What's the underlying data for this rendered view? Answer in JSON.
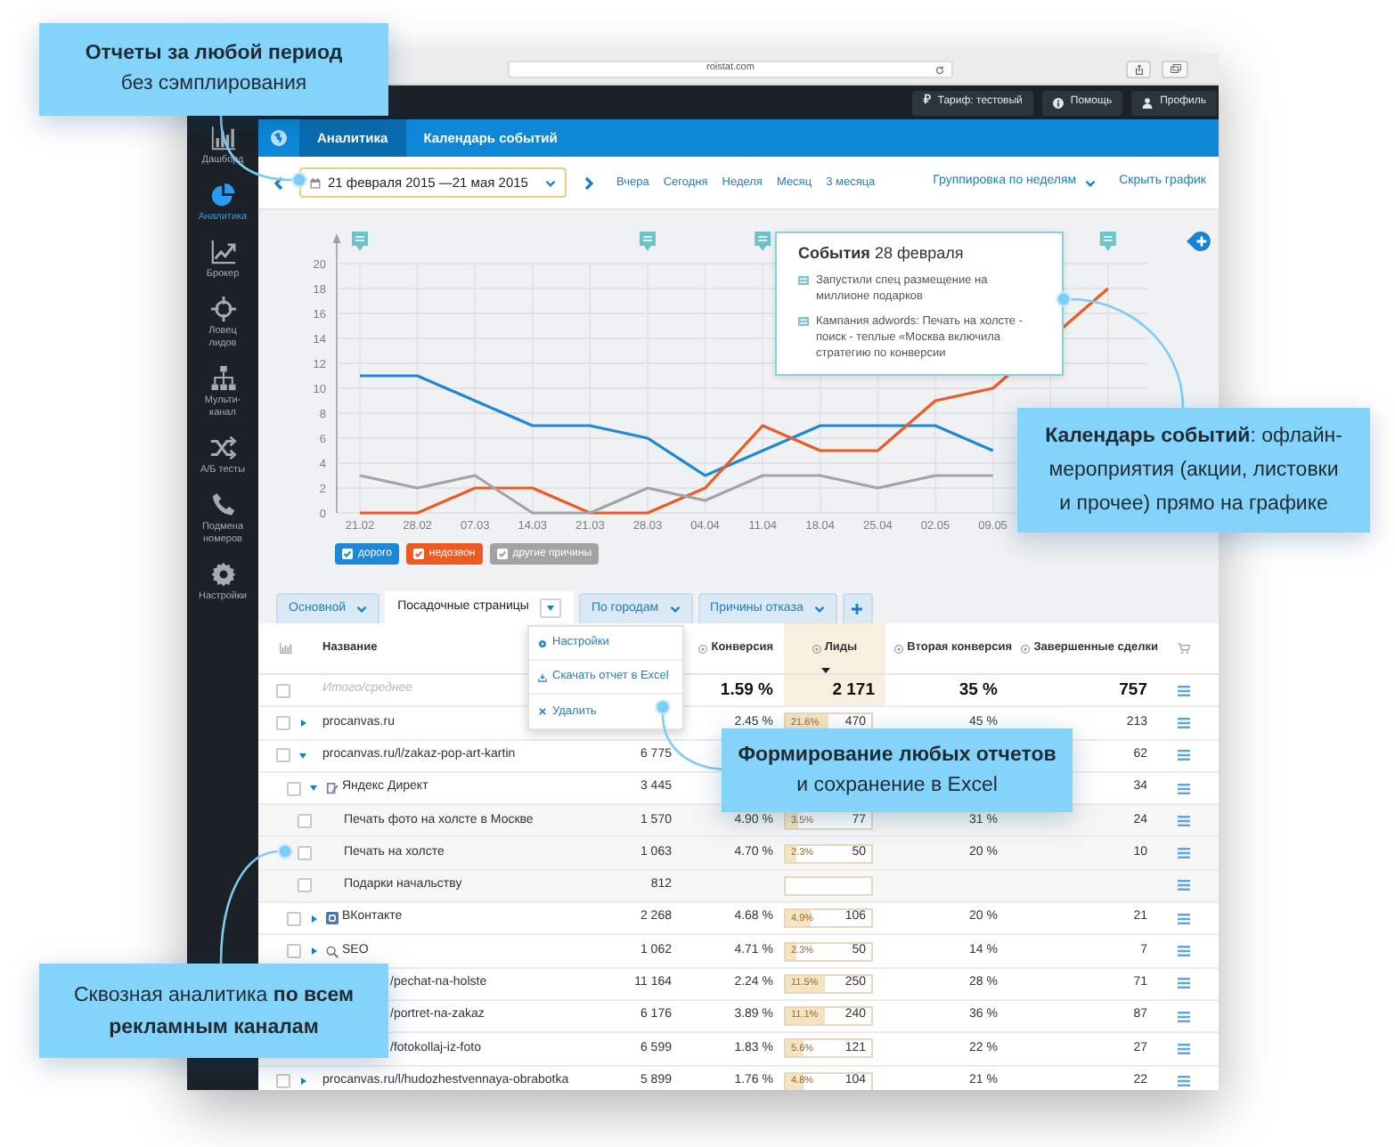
{
  "browser": {
    "url": "roistat.com"
  },
  "header": {
    "buttons": [
      {
        "kind": "tariff",
        "symbol": "₽",
        "label": "Тариф: тестовый"
      },
      {
        "kind": "help",
        "label": "Помощь"
      },
      {
        "kind": "profile",
        "label": "Профиль"
      }
    ]
  },
  "sidebar": {
    "items": [
      {
        "kind": "dashboard",
        "label": "Дашборд",
        "selected": false
      },
      {
        "kind": "analytics",
        "label": "Аналитика",
        "selected": true
      },
      {
        "kind": "broker",
        "label": "Брокер",
        "selected": false
      },
      {
        "kind": "leads",
        "label": "Ловец\nлидов",
        "selected": false
      },
      {
        "kind": "multichannel",
        "label": "Мульти-\nканал",
        "selected": false
      },
      {
        "kind": "ab",
        "label": "А/Б тесты",
        "selected": false
      },
      {
        "kind": "phones",
        "label": "Подмена\nномеров",
        "selected": false
      },
      {
        "kind": "settings",
        "label": "Настройки",
        "selected": false
      }
    ]
  },
  "nav": {
    "tabs": [
      {
        "label": "Аналитика",
        "selected": true
      },
      {
        "label": "Календарь событий",
        "selected": false
      }
    ]
  },
  "date_bar": {
    "range": "21 февраля 2015 —21 мая 2015",
    "quick_ranges": [
      "Вчера",
      "Сегодня",
      "Неделя",
      "Месяц",
      "3 месяца"
    ],
    "grouping": "Группировка по неделям",
    "hide_chart": "Скрыть график"
  },
  "chart": {
    "chart_data": {
      "type": "line",
      "grid": true,
      "categories": [
        "21.02",
        "28.02",
        "07.03",
        "14.03",
        "21.03",
        "28.03",
        "04.04",
        "11.04",
        "18.04",
        "25.04",
        "02.05",
        "09.05",
        null,
        null
      ],
      "ylim": [
        0,
        20
      ],
      "yticks": [
        0,
        2,
        4,
        6,
        8,
        10,
        12,
        14,
        16,
        18,
        20
      ],
      "series": [
        {
          "name": "дорого",
          "color": "#1e88d8",
          "values": [
            11,
            11,
            9,
            7,
            7,
            6,
            3,
            5,
            7,
            7,
            7,
            5,
            null,
            null
          ]
        },
        {
          "name": "недозвон",
          "color": "#ee5a24",
          "values": [
            0,
            0,
            2,
            2,
            0,
            0,
            2,
            7,
            5,
            5,
            9,
            10,
            null,
            18
          ]
        },
        {
          "name": "другие причины",
          "color": "#a3a3a3",
          "values": [
            3,
            2,
            3,
            0,
            0,
            2,
            1,
            3,
            3,
            2,
            3,
            3,
            null,
            null
          ]
        }
      ]
    },
    "legend": [
      {
        "checked": true
      },
      {
        "checked": true
      },
      {
        "checked": true
      }
    ],
    "popup": {
      "title": "**События** 28 февраля",
      "items": [
        "Запустили спец размещение на миллионе подарков",
        "Кампания adwords: Печать на холсте - поиск - теплые «Москва включила стратегию по конверсии"
      ]
    }
  },
  "report_tabs": [
    {
      "label": "Основной",
      "selected": false
    },
    {
      "label": "Посадочные страницы",
      "selected": true
    },
    {
      "label": "По городам",
      "selected": false
    },
    {
      "label": "Причины отказа",
      "selected": false
    }
  ],
  "tab_menu": {
    "items": [
      {
        "kind": "settings",
        "label": "Настройки"
      },
      {
        "kind": "download",
        "label": "Скачать отчет в Excel"
      },
      {
        "kind": "delete",
        "label": "Удалить"
      }
    ]
  },
  "table": {
    "columns": [
      {
        "kind": "name",
        "label": "Название"
      },
      {
        "kind": "metric",
        "label": "Конверсия",
        "sorted": false
      },
      {
        "kind": "metric",
        "label": "Лиды",
        "sorted": true
      },
      {
        "kind": "metric",
        "label": "Вторая конверсия",
        "sorted": false
      },
      {
        "kind": "metric",
        "label": "Завершенные сделки",
        "sorted": false
      }
    ],
    "rows": [
      {
        "kind": "total",
        "name": "Итого/среднее",
        "checked": false,
        "conversion": "1.59 %",
        "leads": {
          "value": "2 171"
        },
        "second_conversion": "35 %",
        "deals": "757"
      },
      {
        "kind": "page",
        "name": "procanvas.ru",
        "checked": false,
        "expanded": false,
        "conversion": "2.45 %",
        "leads": {
          "share": "21.6%",
          "value": "470",
          "level": 0.5
        },
        "second_conversion": "45 %",
        "deals": "213"
      },
      {
        "kind": "page",
        "name": "procanvas.ru/l/zakaz-pop-art-kartin",
        "checked": false,
        "expanded": true,
        "visits": "6 775",
        "deals": "62",
        "children": [
          {
            "kind": "direct",
            "name": "Яндекс Директ",
            "checked": false,
            "expanded": true,
            "visits": "3 445",
            "deals": "34",
            "children": [
              {
                "kind": "phrase",
                "name": "Печать фото на холсте в Москве",
                "checked": false,
                "visits": "1 570",
                "conversion": "4.90 %",
                "leads": {
                  "share": "3.5%",
                  "value": "77",
                  "level": 0.15
                },
                "second_conversion": "31 %",
                "deals": "24"
              },
              {
                "kind": "phrase",
                "name": "Печать на холсте",
                "checked": false,
                "visits": "1 063",
                "conversion": "4.70 %",
                "leads": {
                  "share": "2.3%",
                  "value": "50",
                  "level": 0.12
                },
                "second_conversion": "20 %",
                "deals": "10"
              },
              {
                "kind": "phrase",
                "name": "Подарки начальству",
                "checked": false,
                "visits": "812",
                "leads": {
                  "level": 0
                }
              }
            ]
          },
          {
            "kind": "vk",
            "name": "ВКонтакте",
            "checked": false,
            "expanded": false,
            "visits": "2 268",
            "conversion": "4.68 %",
            "leads": {
              "share": "4.9%",
              "value": "106",
              "level": 0.3
            },
            "second_conversion": "20 %",
            "deals": "21"
          },
          {
            "kind": "seo",
            "name": "SEO",
            "checked": false,
            "expanded": false,
            "visits": "1 062",
            "conversion": "4.71 %",
            "leads": {
              "share": "2.3%",
              "value": "50",
              "level": 0.12
            },
            "second_conversion": "14 %",
            "deals": "7"
          }
        ]
      },
      {
        "kind": "page_tail",
        "name": "/pechat-na-holste",
        "visits": "11 164",
        "conversion": "2.24 %",
        "leads": {
          "share": "11.5%",
          "value": "250",
          "level": 0.45
        },
        "second_conversion": "28 %",
        "deals": "71"
      },
      {
        "kind": "page_tail",
        "name": "/portret-na-zakaz",
        "visits": "6 176",
        "conversion": "3.89 %",
        "leads": {
          "share": "11.1%",
          "value": "240",
          "level": 0.45
        },
        "second_conversion": "36 %",
        "deals": "87"
      },
      {
        "kind": "page_tail",
        "name": "/fotokollaj-iz-foto",
        "visits": "6 599",
        "conversion": "1.83 %",
        "leads": {
          "share": "5.6%",
          "value": "121",
          "level": 0.2
        },
        "second_conversion": "22 %",
        "deals": "27"
      },
      {
        "kind": "page",
        "name": "procanvas.ru/l/hudozhestvennaya-obrabotka",
        "checked": false,
        "expanded": false,
        "visits": "5 899",
        "conversion": "1.76 %",
        "leads": {
          "share": "4.8%",
          "value": "104",
          "level": 0.2
        },
        "second_conversion": "21 %",
        "deals": "22"
      }
    ]
  },
  "callouts": [
    {
      "text": "**Отчеты за любой период**\nбез сэмплирования"
    },
    {
      "text": "**Календарь событий**: офлайн-\nмероприятия (акции, листовки\nи прочее) прямо на графике"
    },
    {
      "text": "**Формирование любых отчетов**\nи сохранение в Excel"
    },
    {
      "text": "Сквозная аналитика **по всем**\n**рекламным каналам**"
    }
  ]
}
